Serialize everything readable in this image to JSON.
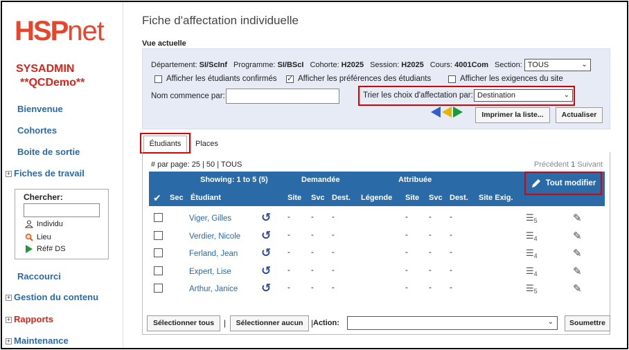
{
  "brand": {
    "logo_h": "HSP",
    "logo_net": "net"
  },
  "sidebar": {
    "user": "SYSADMIN",
    "instance": "**QCDemo**",
    "items": [
      "Bienvenue",
      "Cohortes",
      "Boite de sortie"
    ],
    "fiches": "Fiches de travail",
    "search_label": "Chercher:",
    "search_opts": [
      "Individu",
      "Lieu",
      "Réf# DS"
    ],
    "raccourci": "Raccourci",
    "gestion": "Gestion du contenu",
    "rapports": "Rapports",
    "maintenance": "Maintenance"
  },
  "page": {
    "title": "Fiche d'affectation individuelle",
    "vue": "Vue actuelle"
  },
  "filters": {
    "dept_k": "Département:",
    "dept_v": "SI/ScInf",
    "prog_k": "Programme:",
    "prog_v": "SI/BScI",
    "coh_k": "Cohorte:",
    "coh_v": "H2025",
    "sess_k": "Session:",
    "sess_v": "H2025",
    "cours_k": "Cours:",
    "cours_v": "4001Com",
    "section_k": "Section:",
    "section_v": "TOUS",
    "cb1": "Afficher les étudiants confirmés",
    "cb2": "Afficher les préférences des étudiants",
    "cb3": "Afficher les exigences du site",
    "nom_label": "Nom commence par:",
    "trier_label": "Trier les choix d'affectation par:",
    "trier_value": "Destination",
    "imprimer": "Imprimer la liste...",
    "actualiser": "Actualiser",
    "arrow_colors": [
      "#2f5fd1",
      "#e8b400",
      "#1e9a3c"
    ]
  },
  "tabs": {
    "etudiants": "Étudiants",
    "places": "Places"
  },
  "grid": {
    "per_page": "# par page: 25 | 50 | TOUS",
    "prev": "Précédent",
    "page": "1",
    "next": "Suivant",
    "showing": "Showing: 1 to 5 (5)",
    "demandee": "Demandée",
    "attribuee": "Attribuée",
    "tout_modifier": "Tout modifier",
    "cols": {
      "check": "✔",
      "sec": "Sec",
      "etudiant": "Étudiant",
      "site": "Site",
      "svc": "Svc",
      "dest": "Dest.",
      "legende": "Légende",
      "site2": "Site",
      "svc2": "Svc",
      "dest2": "Dest.",
      "site_exig": "Site Exig."
    },
    "dash": "-",
    "rows": [
      {
        "name": "Viger, Gilles",
        "count": "5"
      },
      {
        "name": "Verdier, Nicole",
        "count": "4"
      },
      {
        "name": "Ferland, Jean",
        "count": "4"
      },
      {
        "name": "Expert, Lise",
        "count": "4"
      },
      {
        "name": "Arthur, Janice",
        "count": "5"
      }
    ]
  },
  "bottom": {
    "select_all": "Sélectionner tous",
    "select_none": "Sélectionner aucun",
    "action": "Action:",
    "submit": "Soumettre"
  }
}
